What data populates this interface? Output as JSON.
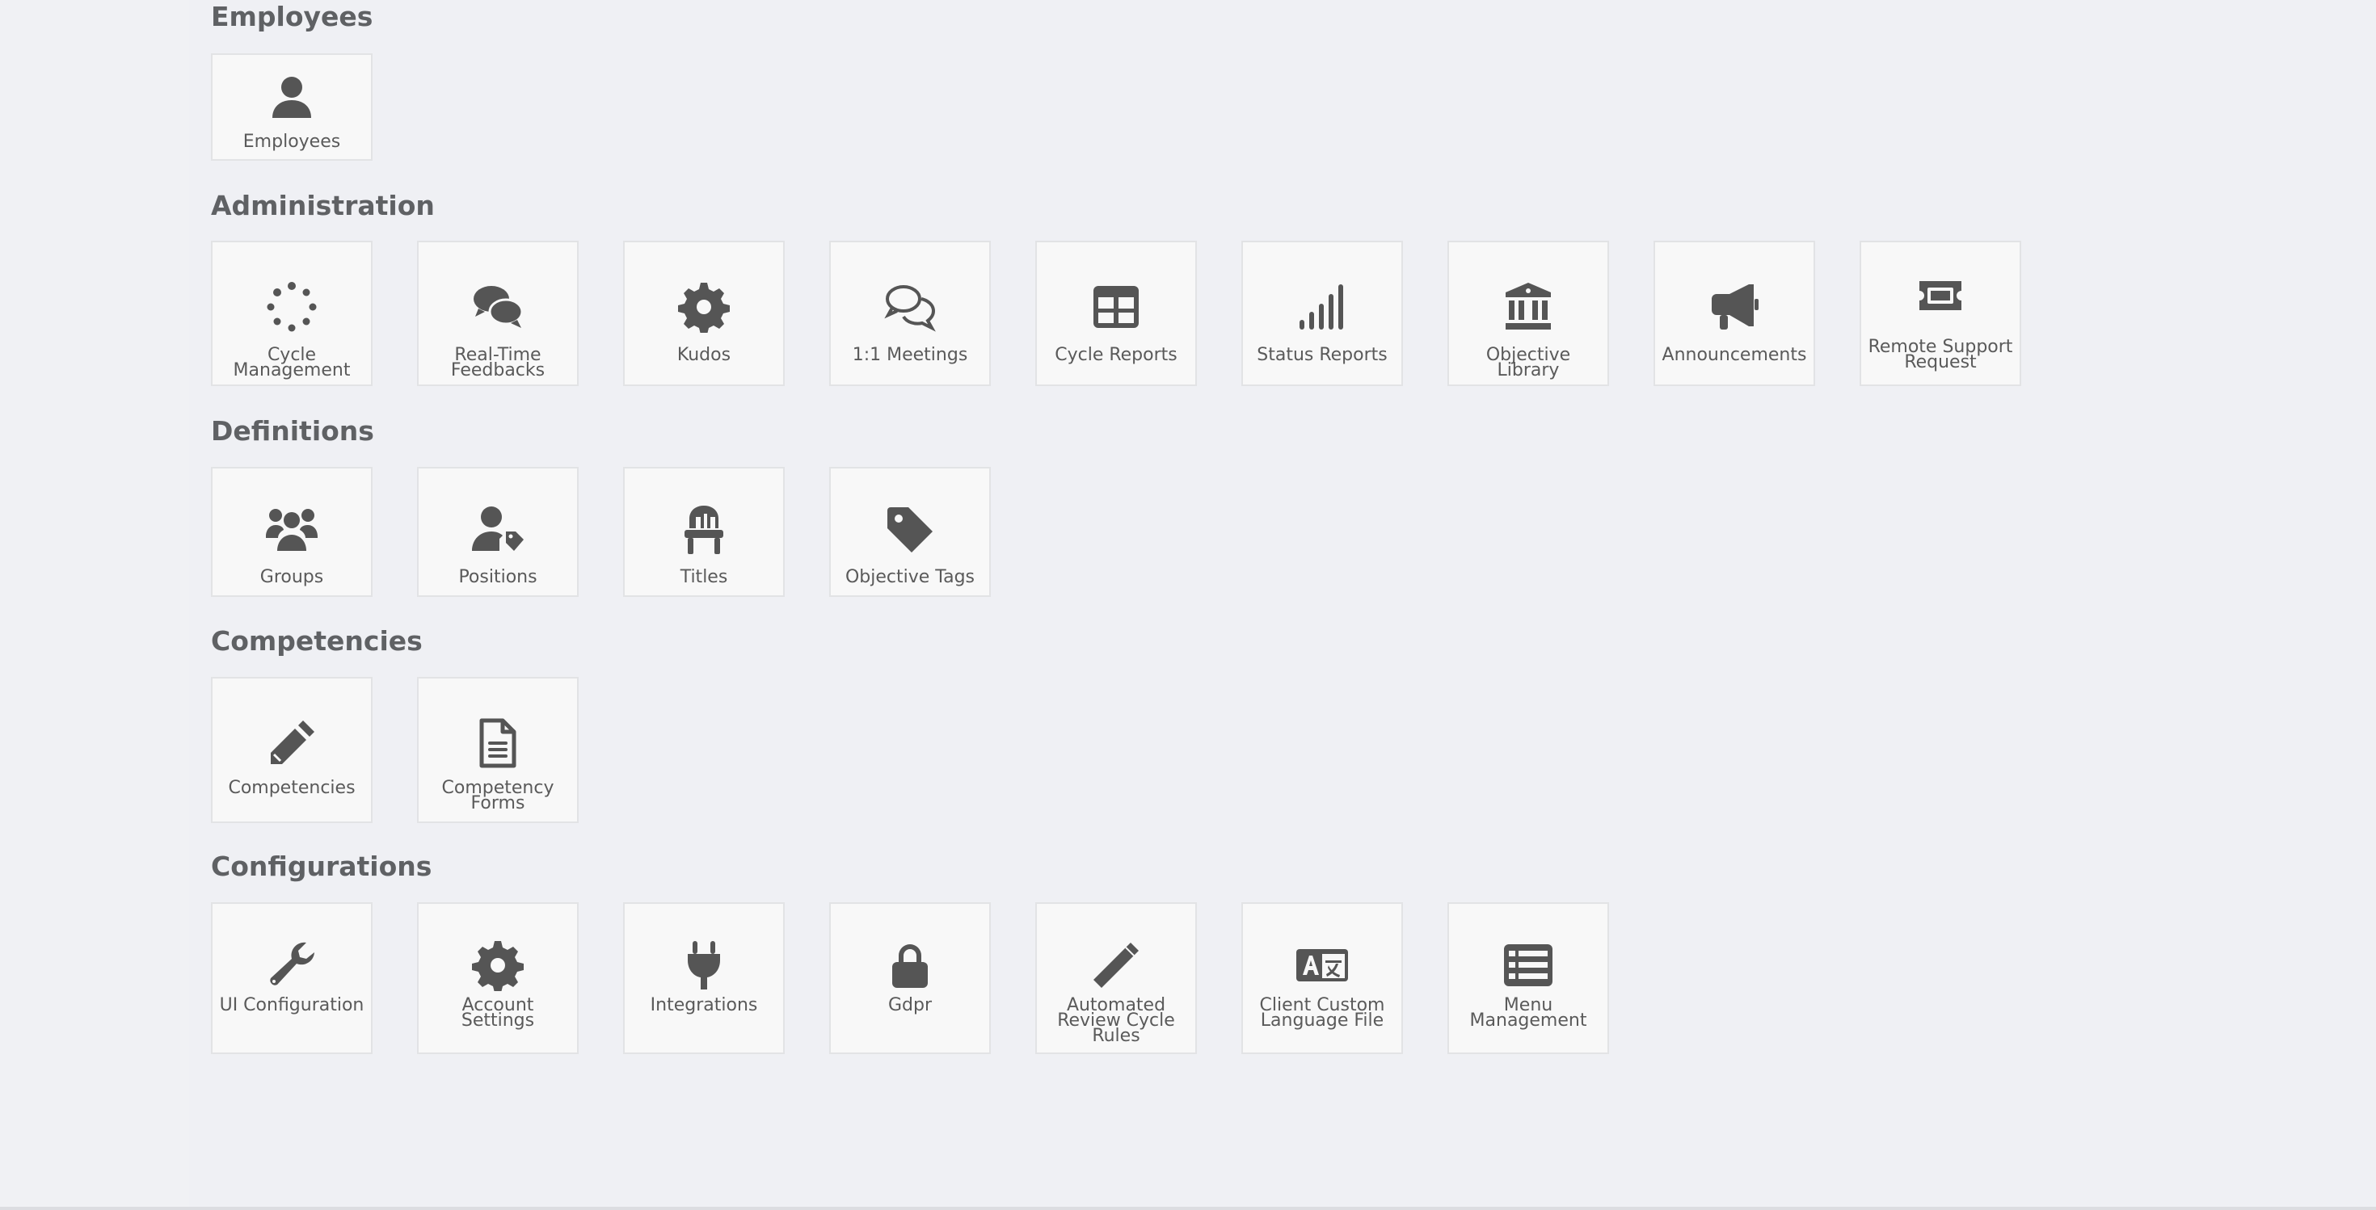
{
  "sections": {
    "employees": {
      "title": "Employees",
      "items": [
        {
          "label": "Employees",
          "icon": "user-icon"
        }
      ]
    },
    "administration": {
      "title": "Administration",
      "items": [
        {
          "label": "Cycle Management",
          "icon": "spinner-icon"
        },
        {
          "label": "Real-Time Feedbacks",
          "icon": "chat-bubbles-icon"
        },
        {
          "label": "Kudos",
          "icon": "gear-icon"
        },
        {
          "label": "1:1 Meetings",
          "icon": "chat-outline-icon"
        },
        {
          "label": "Cycle Reports",
          "icon": "table-icon"
        },
        {
          "label": "Status Reports",
          "icon": "signal-bars-icon"
        },
        {
          "label": "Objective Library",
          "icon": "bank-icon"
        },
        {
          "label": "Announcements",
          "icon": "megaphone-icon"
        },
        {
          "label": "Remote Support Request",
          "icon": "ticket-icon"
        }
      ]
    },
    "definitions": {
      "title": "Definitions",
      "items": [
        {
          "label": "Groups",
          "icon": "users-icon"
        },
        {
          "label": "Positions",
          "icon": "user-tag-icon"
        },
        {
          "label": "Titles",
          "icon": "chair-icon"
        },
        {
          "label": "Objective Tags",
          "icon": "tag-icon"
        }
      ]
    },
    "competencies": {
      "title": "Competencies",
      "items": [
        {
          "label": "Competencies",
          "icon": "pencil-icon"
        },
        {
          "label": "Competency Forms",
          "icon": "document-icon"
        }
      ]
    },
    "configurations": {
      "title": "Configurations",
      "items": [
        {
          "label": "UI Configuration",
          "icon": "wrench-icon"
        },
        {
          "label": "Account Settings",
          "icon": "gear-icon"
        },
        {
          "label": "Integrations",
          "icon": "plug-icon"
        },
        {
          "label": "Gdpr",
          "icon": "lock-icon"
        },
        {
          "label": "Automated Review Cycle Rules",
          "icon": "magic-wand-icon"
        },
        {
          "label": "Client Custom Language File",
          "icon": "language-icon"
        },
        {
          "label": "Menu Management",
          "icon": "list-icon"
        }
      ]
    }
  }
}
